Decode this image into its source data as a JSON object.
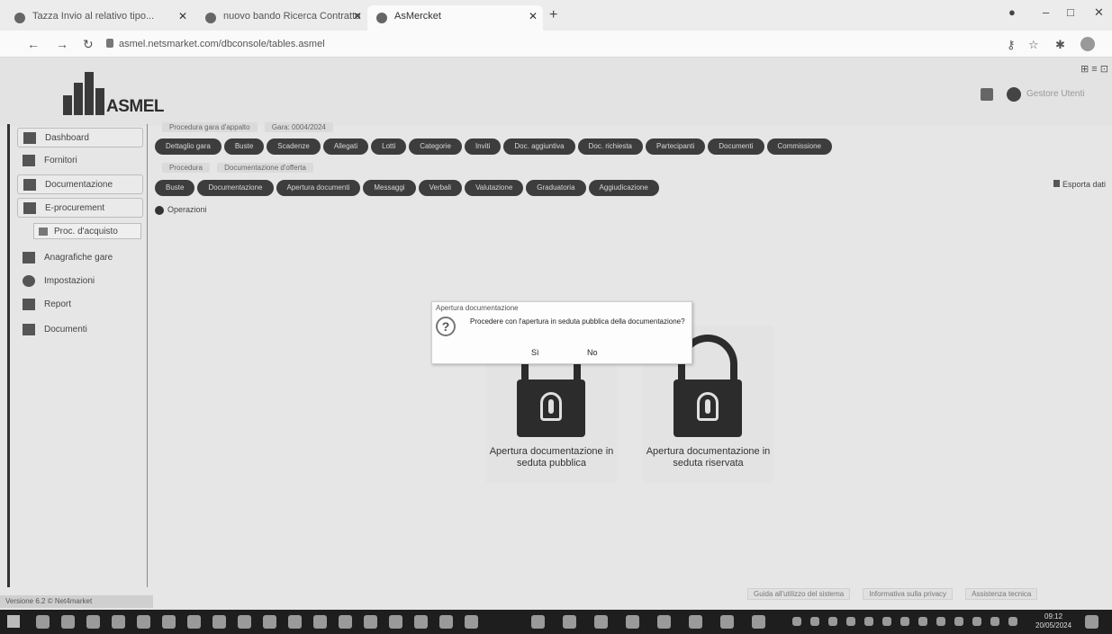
{
  "browser": {
    "tabs": [
      {
        "label": "Tazza Invio al relativo tipo..."
      },
      {
        "label": "nuovo bando Ricerca Contratto"
      },
      {
        "label": "AsMercket"
      }
    ],
    "url": "asmel.netsmarket.com/dbconsole/tables.asmel"
  },
  "header": {
    "logo_text": "ASMEL",
    "top_right_label": "⊞ ≡ ⊡",
    "username": "Gestore Utenti"
  },
  "sidebar": {
    "items": [
      {
        "label": "Dashboard"
      },
      {
        "label": "Fornitori"
      },
      {
        "label": "Documentazione"
      },
      {
        "label": "E-procurement"
      },
      {
        "label": "Proc. d'acquisto"
      },
      {
        "label": "Anagrafiche gare"
      },
      {
        "label": "Impostazioni"
      },
      {
        "label": "Report"
      },
      {
        "label": "Documenti"
      }
    ],
    "footer": "Versione 6.2 © Net4market"
  },
  "breadcrumb": {
    "row1": [
      "Procedura gara d'appalto",
      "Gara: 0004/2024"
    ],
    "row2": [
      "Procedura",
      "Documentazione d'offerta"
    ]
  },
  "pill_rows": {
    "row1": [
      "Dettaglio gara",
      "Buste",
      "Scadenze",
      "Allegati",
      "Lotti",
      "Categorie",
      "Inviti",
      "Doc. aggiuntiva",
      "Doc. richiesta",
      "Partecipanti",
      "Documenti",
      "Commissione"
    ],
    "row2": [
      "Buste",
      "Documentazione",
      "Apertura documenti",
      "Messaggi",
      "Verbali",
      "Valutazione",
      "Graduatoria",
      "Aggiudicazione"
    ]
  },
  "dashboard_button": "Operazioni",
  "right_link": "Esporta dati",
  "lock_cards": [
    {
      "label": "Apertura documentazione in seduta pubblica"
    },
    {
      "label": "Apertura documentazione in seduta riservata"
    }
  ],
  "dialog": {
    "title": "Apertura documentazione",
    "message": "Procedere con l'apertura in seduta pubblica della documentazione?",
    "yes": "Sì",
    "no": "No"
  },
  "footer_links": [
    "Guida all'utilizzo del sistema",
    "Informativa sulla privacy",
    "Assistenza tecnica"
  ],
  "taskbar": {
    "clock_time": "09:12",
    "clock_date": "20/05/2024"
  }
}
